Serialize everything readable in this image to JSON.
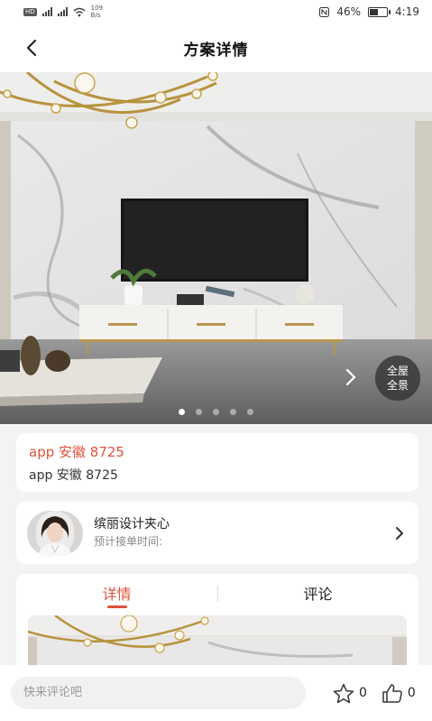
{
  "status_bar": {
    "network_speed_value": "109",
    "network_speed_unit": "B/s",
    "battery": "46%",
    "time": "4:19",
    "hd_label": "HD"
  },
  "header": {
    "title": "方案详情"
  },
  "hero": {
    "panorama_label_line1": "全屋",
    "panorama_label_line2": "全景",
    "image_count": 5,
    "active_index": 0
  },
  "plan": {
    "title": "app 安徽 8725",
    "subtitle": "app 安徽 8725"
  },
  "designer": {
    "name": "缤丽设计夹心",
    "eta_label": "预计接单时间:"
  },
  "tabs": [
    {
      "label": "详情",
      "active": true
    },
    {
      "label": "评论",
      "active": false
    }
  ],
  "bottom_bar": {
    "comment_placeholder": "快来评论吧",
    "favorite_count": "0",
    "like_count": "0"
  },
  "colors": {
    "accent": "#e0513a",
    "background": "#f3f3f3"
  }
}
